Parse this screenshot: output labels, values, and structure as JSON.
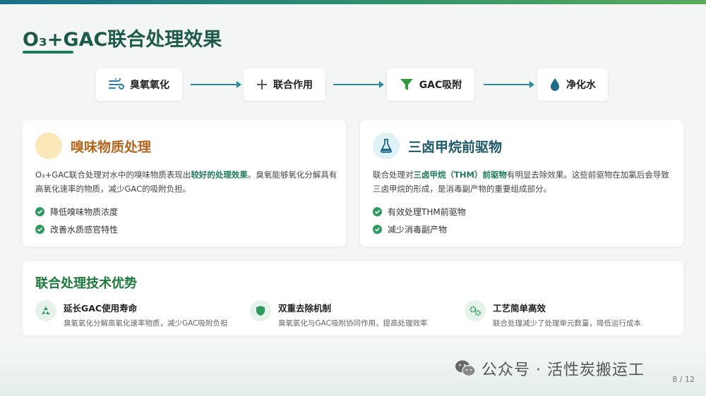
{
  "title": "O₃+GAC联合处理效果",
  "flow": [
    {
      "label": "臭氧氧化",
      "icon": "wind-icon"
    },
    {
      "label": "联合作用",
      "icon": "plus-icon"
    },
    {
      "label": "GAC吸附",
      "icon": "filter-icon"
    },
    {
      "label": "净化水",
      "icon": "water-drop-icon"
    }
  ],
  "odor_card": {
    "title": "嗅味物质处理",
    "desc_before": "O₃+GAC联合处理对水中的嗅味物质表现出",
    "desc_highlight": "较好的处理效果",
    "desc_after": "。臭氧能够氧化分解具有高氧化速率的物质，减少GAC的吸附负担。",
    "points": [
      "降低嗅味物质浓度",
      "改善水质感官特性"
    ]
  },
  "thm_card": {
    "title": "三卤甲烷前驱物",
    "icon": "flask-icon",
    "desc_before": "联合处理对",
    "desc_highlight": "三卤甲烷（THM）前驱物",
    "desc_after": "有明显去除效果。这些前驱物在加氯后会导致三卤甲烷的形成，是消毒副产物的重要组成部分。",
    "points": [
      "有效处理THM前驱物",
      "减少消毒副产物"
    ]
  },
  "advantages": {
    "title": "联合处理技术优势",
    "items": [
      {
        "name": "延长GAC使用寿命",
        "desc": "臭氧氧化分解高氧化速率物质，减少GAC吸附负担",
        "icon": "recycle-icon"
      },
      {
        "name": "双重去除机制",
        "desc": "臭氧氧化与GAC吸附协同作用，提高处理效率",
        "icon": "shield-icon"
      },
      {
        "name": "工艺简单高效",
        "desc": "联合处理减少了处理单元数量，降低运行成本",
        "icon": "gears-icon"
      }
    ]
  },
  "watermark": "公众号 · 活性炭搬运工",
  "page_number": "8 / 12",
  "colors": {
    "primary": "#1d5a4a",
    "accent": "#1d7a5c",
    "odor": "#b5651d",
    "thm": "#1d5a6a"
  }
}
